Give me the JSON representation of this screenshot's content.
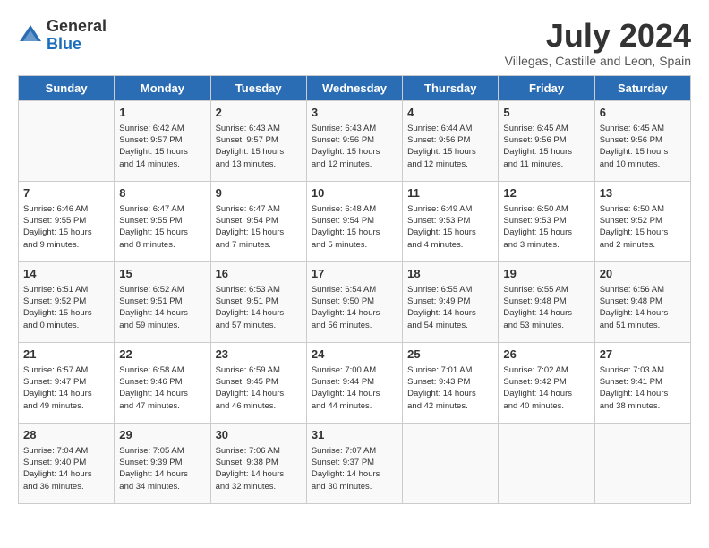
{
  "logo": {
    "general": "General",
    "blue": "Blue"
  },
  "title": "July 2024",
  "location": "Villegas, Castille and Leon, Spain",
  "days_header": [
    "Sunday",
    "Monday",
    "Tuesday",
    "Wednesday",
    "Thursday",
    "Friday",
    "Saturday"
  ],
  "weeks": [
    [
      {
        "day": "",
        "sunrise": "",
        "sunset": "",
        "daylight": ""
      },
      {
        "day": "1",
        "sunrise": "Sunrise: 6:42 AM",
        "sunset": "Sunset: 9:57 PM",
        "daylight": "Daylight: 15 hours and 14 minutes."
      },
      {
        "day": "2",
        "sunrise": "Sunrise: 6:43 AM",
        "sunset": "Sunset: 9:57 PM",
        "daylight": "Daylight: 15 hours and 13 minutes."
      },
      {
        "day": "3",
        "sunrise": "Sunrise: 6:43 AM",
        "sunset": "Sunset: 9:56 PM",
        "daylight": "Daylight: 15 hours and 12 minutes."
      },
      {
        "day": "4",
        "sunrise": "Sunrise: 6:44 AM",
        "sunset": "Sunset: 9:56 PM",
        "daylight": "Daylight: 15 hours and 12 minutes."
      },
      {
        "day": "5",
        "sunrise": "Sunrise: 6:45 AM",
        "sunset": "Sunset: 9:56 PM",
        "daylight": "Daylight: 15 hours and 11 minutes."
      },
      {
        "day": "6",
        "sunrise": "Sunrise: 6:45 AM",
        "sunset": "Sunset: 9:56 PM",
        "daylight": "Daylight: 15 hours and 10 minutes."
      }
    ],
    [
      {
        "day": "7",
        "sunrise": "Sunrise: 6:46 AM",
        "sunset": "Sunset: 9:55 PM",
        "daylight": "Daylight: 15 hours and 9 minutes."
      },
      {
        "day": "8",
        "sunrise": "Sunrise: 6:47 AM",
        "sunset": "Sunset: 9:55 PM",
        "daylight": "Daylight: 15 hours and 8 minutes."
      },
      {
        "day": "9",
        "sunrise": "Sunrise: 6:47 AM",
        "sunset": "Sunset: 9:54 PM",
        "daylight": "Daylight: 15 hours and 7 minutes."
      },
      {
        "day": "10",
        "sunrise": "Sunrise: 6:48 AM",
        "sunset": "Sunset: 9:54 PM",
        "daylight": "Daylight: 15 hours and 5 minutes."
      },
      {
        "day": "11",
        "sunrise": "Sunrise: 6:49 AM",
        "sunset": "Sunset: 9:53 PM",
        "daylight": "Daylight: 15 hours and 4 minutes."
      },
      {
        "day": "12",
        "sunrise": "Sunrise: 6:50 AM",
        "sunset": "Sunset: 9:53 PM",
        "daylight": "Daylight: 15 hours and 3 minutes."
      },
      {
        "day": "13",
        "sunrise": "Sunrise: 6:50 AM",
        "sunset": "Sunset: 9:52 PM",
        "daylight": "Daylight: 15 hours and 2 minutes."
      }
    ],
    [
      {
        "day": "14",
        "sunrise": "Sunrise: 6:51 AM",
        "sunset": "Sunset: 9:52 PM",
        "daylight": "Daylight: 15 hours and 0 minutes."
      },
      {
        "day": "15",
        "sunrise": "Sunrise: 6:52 AM",
        "sunset": "Sunset: 9:51 PM",
        "daylight": "Daylight: 14 hours and 59 minutes."
      },
      {
        "day": "16",
        "sunrise": "Sunrise: 6:53 AM",
        "sunset": "Sunset: 9:51 PM",
        "daylight": "Daylight: 14 hours and 57 minutes."
      },
      {
        "day": "17",
        "sunrise": "Sunrise: 6:54 AM",
        "sunset": "Sunset: 9:50 PM",
        "daylight": "Daylight: 14 hours and 56 minutes."
      },
      {
        "day": "18",
        "sunrise": "Sunrise: 6:55 AM",
        "sunset": "Sunset: 9:49 PM",
        "daylight": "Daylight: 14 hours and 54 minutes."
      },
      {
        "day": "19",
        "sunrise": "Sunrise: 6:55 AM",
        "sunset": "Sunset: 9:48 PM",
        "daylight": "Daylight: 14 hours and 53 minutes."
      },
      {
        "day": "20",
        "sunrise": "Sunrise: 6:56 AM",
        "sunset": "Sunset: 9:48 PM",
        "daylight": "Daylight: 14 hours and 51 minutes."
      }
    ],
    [
      {
        "day": "21",
        "sunrise": "Sunrise: 6:57 AM",
        "sunset": "Sunset: 9:47 PM",
        "daylight": "Daylight: 14 hours and 49 minutes."
      },
      {
        "day": "22",
        "sunrise": "Sunrise: 6:58 AM",
        "sunset": "Sunset: 9:46 PM",
        "daylight": "Daylight: 14 hours and 47 minutes."
      },
      {
        "day": "23",
        "sunrise": "Sunrise: 6:59 AM",
        "sunset": "Sunset: 9:45 PM",
        "daylight": "Daylight: 14 hours and 46 minutes."
      },
      {
        "day": "24",
        "sunrise": "Sunrise: 7:00 AM",
        "sunset": "Sunset: 9:44 PM",
        "daylight": "Daylight: 14 hours and 44 minutes."
      },
      {
        "day": "25",
        "sunrise": "Sunrise: 7:01 AM",
        "sunset": "Sunset: 9:43 PM",
        "daylight": "Daylight: 14 hours and 42 minutes."
      },
      {
        "day": "26",
        "sunrise": "Sunrise: 7:02 AM",
        "sunset": "Sunset: 9:42 PM",
        "daylight": "Daylight: 14 hours and 40 minutes."
      },
      {
        "day": "27",
        "sunrise": "Sunrise: 7:03 AM",
        "sunset": "Sunset: 9:41 PM",
        "daylight": "Daylight: 14 hours and 38 minutes."
      }
    ],
    [
      {
        "day": "28",
        "sunrise": "Sunrise: 7:04 AM",
        "sunset": "Sunset: 9:40 PM",
        "daylight": "Daylight: 14 hours and 36 minutes."
      },
      {
        "day": "29",
        "sunrise": "Sunrise: 7:05 AM",
        "sunset": "Sunset: 9:39 PM",
        "daylight": "Daylight: 14 hours and 34 minutes."
      },
      {
        "day": "30",
        "sunrise": "Sunrise: 7:06 AM",
        "sunset": "Sunset: 9:38 PM",
        "daylight": "Daylight: 14 hours and 32 minutes."
      },
      {
        "day": "31",
        "sunrise": "Sunrise: 7:07 AM",
        "sunset": "Sunset: 9:37 PM",
        "daylight": "Daylight: 14 hours and 30 minutes."
      },
      {
        "day": "",
        "sunrise": "",
        "sunset": "",
        "daylight": ""
      },
      {
        "day": "",
        "sunrise": "",
        "sunset": "",
        "daylight": ""
      },
      {
        "day": "",
        "sunrise": "",
        "sunset": "",
        "daylight": ""
      }
    ]
  ]
}
